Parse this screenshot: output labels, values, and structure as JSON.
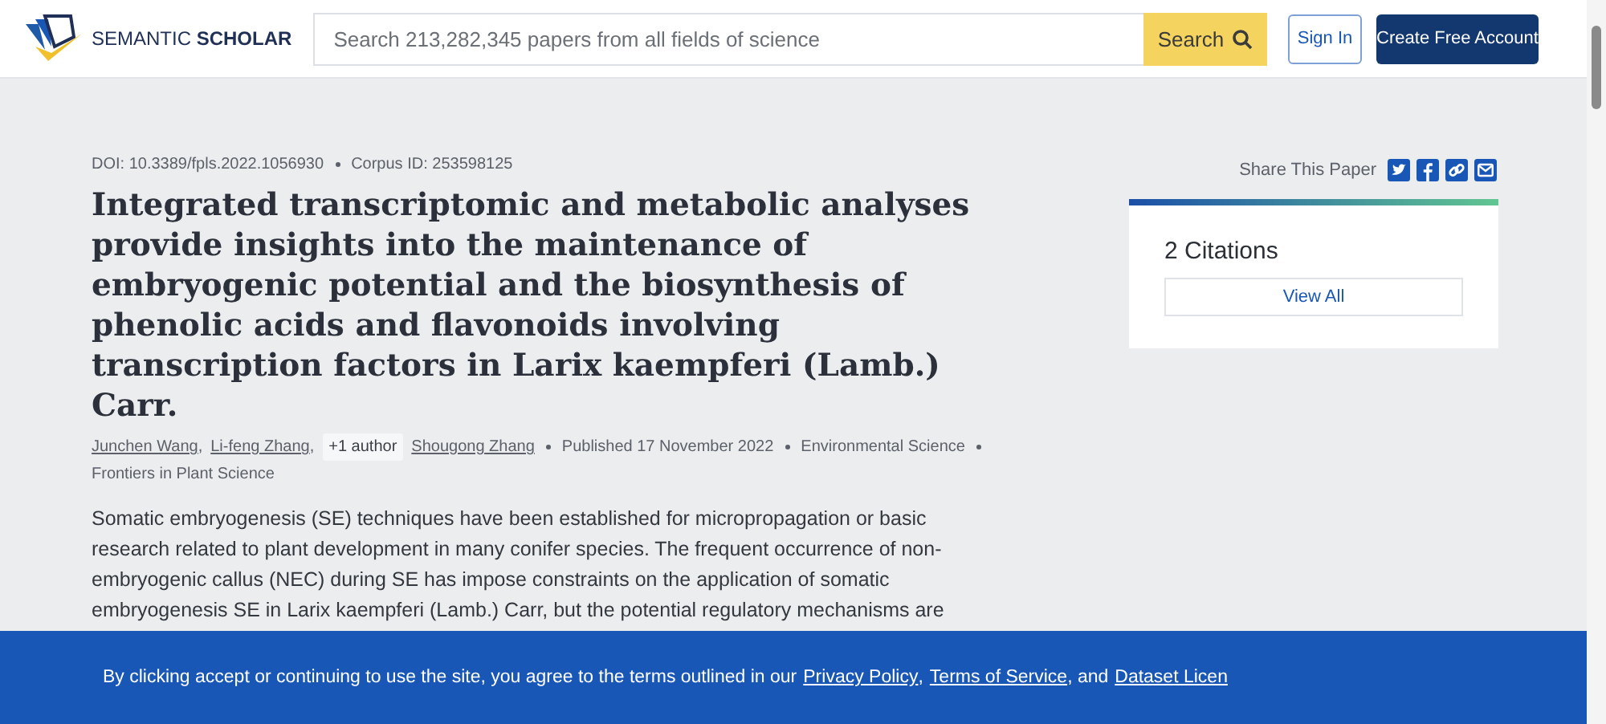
{
  "header": {
    "logo_text_1": "SEMANTIC",
    "logo_text_2": "SCHOLAR",
    "search": {
      "placeholder": "Search 213,282,345 papers from all fields of science"
    },
    "search_button": "Search",
    "sign_in": "Sign In",
    "create_account": "Create Free Account"
  },
  "paper": {
    "doi": "DOI: 10.3389/fpls.2022.1056930",
    "corpus_id": "Corpus ID: 253598125",
    "title": "Integrated transcriptomic and metabolic analyses provide insights into the maintenance of embryogenic potential and the biosynthesis of phenolic acids and flavonoids involving transcription factors in Larix kaempferi (Lamb.) Carr.",
    "authors": [
      {
        "name": "Junchen Wang",
        "kind": "link",
        "sep": ","
      },
      {
        "name": "Li-feng Zhang",
        "kind": "link",
        "sep": ","
      },
      {
        "name": "+1 author",
        "kind": "more"
      },
      {
        "name": "Shougong Zhang",
        "kind": "link"
      }
    ],
    "published": "Published 17 November 2022",
    "field": "Environmental Science",
    "venue": "Frontiers in Plant Science",
    "abstract": "Somatic embryogenesis (SE) techniques have been established for micropropagation or basic research related to plant development in many conifer species. The frequent occurrence of non-embryogenic callus (NEC) during SE has impose constraints on the application of somatic embryogenesis SE in Larix kaempferi (Lamb.) Carr, but the potential regulatory mechanisms are"
  },
  "share": {
    "label": "Share This Paper",
    "icons": [
      {
        "kind": "twitter"
      },
      {
        "kind": "facebook"
      },
      {
        "kind": "link"
      },
      {
        "kind": "email"
      }
    ]
  },
  "citations": {
    "title": "2 Citations",
    "button": "View All"
  },
  "cookie_banner": {
    "text": "By clicking accept or continuing to use the site, you agree to the terms outlined in our",
    "links": [
      {
        "text": "Privacy Policy",
        "after": ","
      },
      {
        "text": "Terms of Service",
        "after": ", and"
      },
      {
        "text": "Dataset Licen"
      }
    ]
  }
}
